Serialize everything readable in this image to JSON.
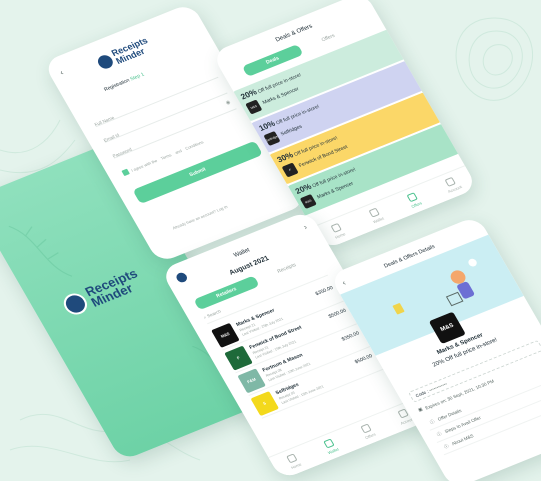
{
  "brand": {
    "name_line1": "Receipts",
    "name_line2": "Minder",
    "primary": "#5ccf9b",
    "dark": "#1f4a7c"
  },
  "registration": {
    "title": "Registration",
    "step": "Step 1",
    "fields": [
      "Full Name",
      "Email id",
      "Password"
    ],
    "agree_prefix": "I agree with the",
    "terms": "Terms",
    "and": "and",
    "conditions": "Conditions",
    "submit": "Submit",
    "account_question": "Already have an account?",
    "login": "Log In"
  },
  "deals": {
    "title": "Deals & Offers",
    "tabs": [
      "Deals",
      "Offers"
    ],
    "items": [
      {
        "pct": "20%",
        "text": "Off full price in-store!",
        "shop": "Marks & Spencer",
        "logo": "M&S",
        "color": "#ccecdd"
      },
      {
        "pct": "10%",
        "text": "Off full price in-store!",
        "shop": "Selfridges",
        "logo": "Selfridges",
        "color": "#cfd3f1"
      },
      {
        "pct": "30%",
        "text": "Off full price in-store!",
        "shop": "Fenwick of Bond Street",
        "logo": "F",
        "color": "#fbd768"
      },
      {
        "pct": "20%",
        "text": "Off full price in-store!",
        "shop": "Marks & Spencer",
        "logo": "M&S",
        "color": "#a8e3c7"
      }
    ],
    "nav": [
      "Home",
      "Wallet",
      "Offers",
      "Account"
    ]
  },
  "wallet": {
    "title": "Wallet",
    "month": "August 2021",
    "tabs": [
      "Retailers",
      "Receipts"
    ],
    "search_placeholder": "Search",
    "rows": [
      {
        "name": "Marks & Spencer",
        "line1": "Receipt 21",
        "line2": "Last Visited : 25th July 2021",
        "amount": "$350.00",
        "logo": "M&S",
        "color": "#111111"
      },
      {
        "name": "Fenwick of Bond Street",
        "line1": "Receipt 21",
        "line2": "Last Visited : 15th July 2021",
        "amount": "$500.00",
        "logo": "F",
        "color": "#1e6a3a"
      },
      {
        "name": "Fortnum & Mason",
        "line1": "Receipt 08",
        "line2": "Last Visited : 10th June 2021",
        "amount": "$350.00",
        "logo": "F&M",
        "color": "#7fb8a6"
      },
      {
        "name": "Selfridges",
        "line1": "Receipt 03",
        "line2": "Last Visited : 15th June 2021",
        "amount": "$500.00",
        "logo": "S",
        "color": "#f3d91c"
      }
    ],
    "nav": [
      "Home",
      "Wallet",
      "Offers",
      "Account"
    ]
  },
  "detail": {
    "title": "Deals & Offers Details",
    "shop": "Marks & Spencer",
    "logo": "M&S",
    "offer": "20% Off full price in-store!",
    "code_label": "Code :",
    "code_value": "••••••••••••",
    "expires": "Expires on: 30 Sept, 2021, 10:30 PM",
    "items": [
      "Offer Details",
      "Steps to Avail Offer",
      "About M&S"
    ]
  }
}
